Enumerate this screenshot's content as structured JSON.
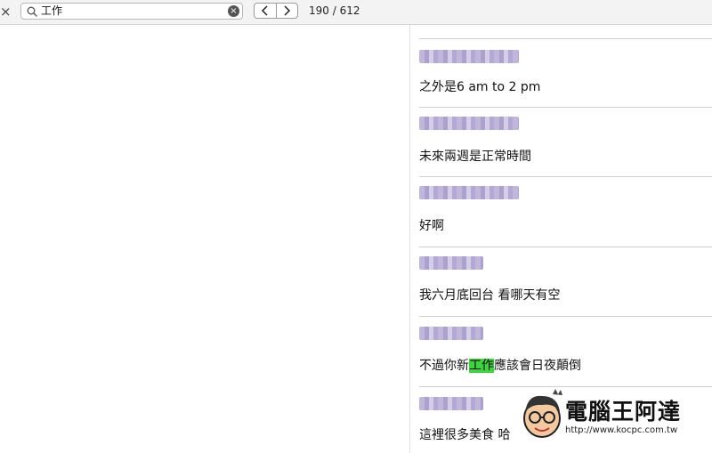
{
  "findbar": {
    "close_glyph": "×",
    "search_value": "工作",
    "clear_glyph": "×",
    "prev_glyph": "<",
    "next_glyph": ">",
    "match_count": "190 / 612"
  },
  "messages": [
    {
      "text": "之外是6 am to 2 pm"
    },
    {
      "text": "未來兩週是正常時間"
    },
    {
      "text": "好啊"
    },
    {
      "text": "我六月底回台 看哪天有空"
    },
    {
      "text_before": "不過你新",
      "highlight": "工作",
      "text_after": "應該會日夜顛倒"
    },
    {
      "text": "這裡很多美食 哈"
    }
  ],
  "watermark": {
    "title": "電腦王阿達",
    "url": "http://www.kocpc.com.tw"
  },
  "colors": {
    "highlight": "#3fd33f",
    "findbar_bg": "#f3f3f3"
  }
}
